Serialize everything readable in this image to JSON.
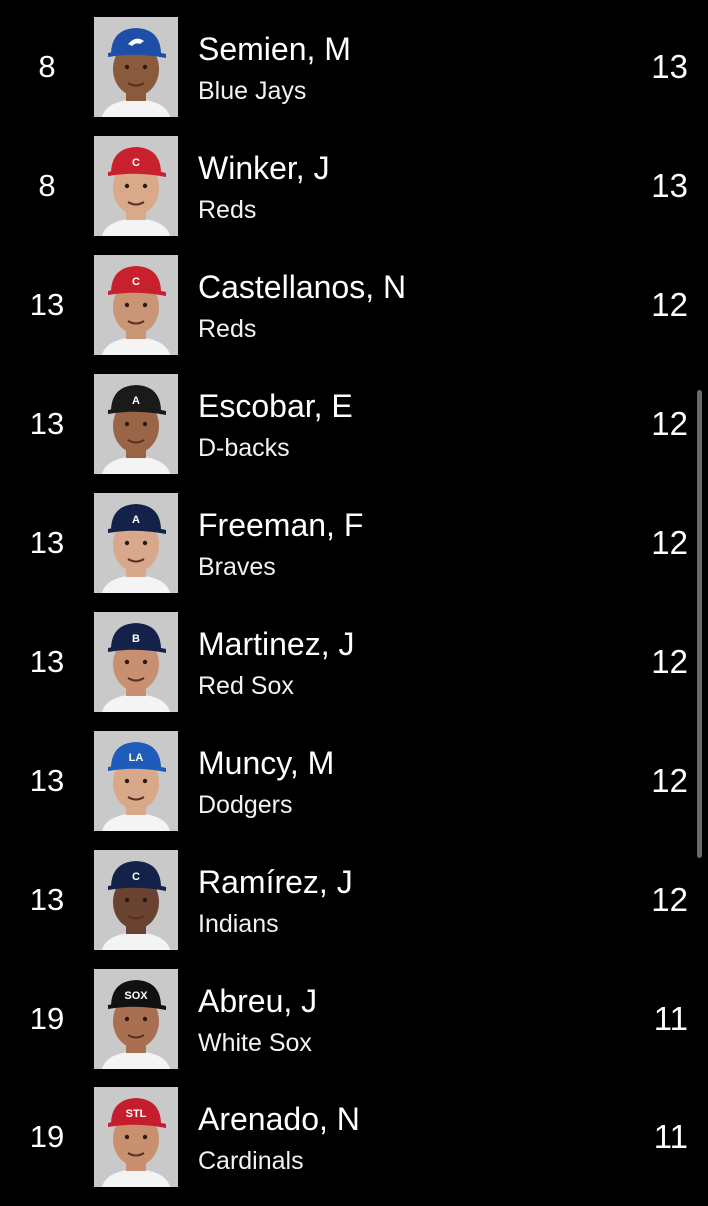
{
  "leaderboard": {
    "rows": [
      {
        "rank": "8",
        "name": "Semien, M",
        "team": "Blue Jays",
        "value": "13",
        "cap_color": "#1d4fa8",
        "cap_logo": "bird-icon",
        "skin": "#8a5a3c"
      },
      {
        "rank": "8",
        "name": "Winker, J",
        "team": "Reds",
        "value": "13",
        "cap_color": "#c8202c",
        "cap_logo": "C",
        "skin": "#d9a98a"
      },
      {
        "rank": "13",
        "name": "Castellanos, N",
        "team": "Reds",
        "value": "12",
        "cap_color": "#c8202c",
        "cap_logo": "C",
        "skin": "#c99574"
      },
      {
        "rank": "13",
        "name": "Escobar, E",
        "team": "D-backs",
        "value": "12",
        "cap_color": "#1a1a1a",
        "cap_logo": "A",
        "skin": "#9a6547"
      },
      {
        "rank": "13",
        "name": "Freeman, F",
        "team": "Braves",
        "value": "12",
        "cap_color": "#14224a",
        "cap_logo": "A",
        "skin": "#d8a88a"
      },
      {
        "rank": "13",
        "name": "Martinez, J",
        "team": "Red Sox",
        "value": "12",
        "cap_color": "#14224a",
        "cap_logo": "B",
        "skin": "#c89070"
      },
      {
        "rank": "13",
        "name": "Muncy, M",
        "team": "Dodgers",
        "value": "12",
        "cap_color": "#1f5bb8",
        "cap_logo": "LA",
        "skin": "#d9a888"
      },
      {
        "rank": "13",
        "name": "Ramírez, J",
        "team": "Indians",
        "value": "12",
        "cap_color": "#14224a",
        "cap_logo": "C",
        "skin": "#6a4330"
      },
      {
        "rank": "19",
        "name": "Abreu, J",
        "team": "White Sox",
        "value": "11",
        "cap_color": "#111111",
        "cap_logo": "SOX",
        "skin": "#a87050"
      },
      {
        "rank": "19",
        "name": "Arenado, N",
        "team": "Cardinals",
        "value": "11",
        "cap_color": "#c41e2e",
        "cap_logo": "STL",
        "skin": "#c99070"
      }
    ]
  }
}
